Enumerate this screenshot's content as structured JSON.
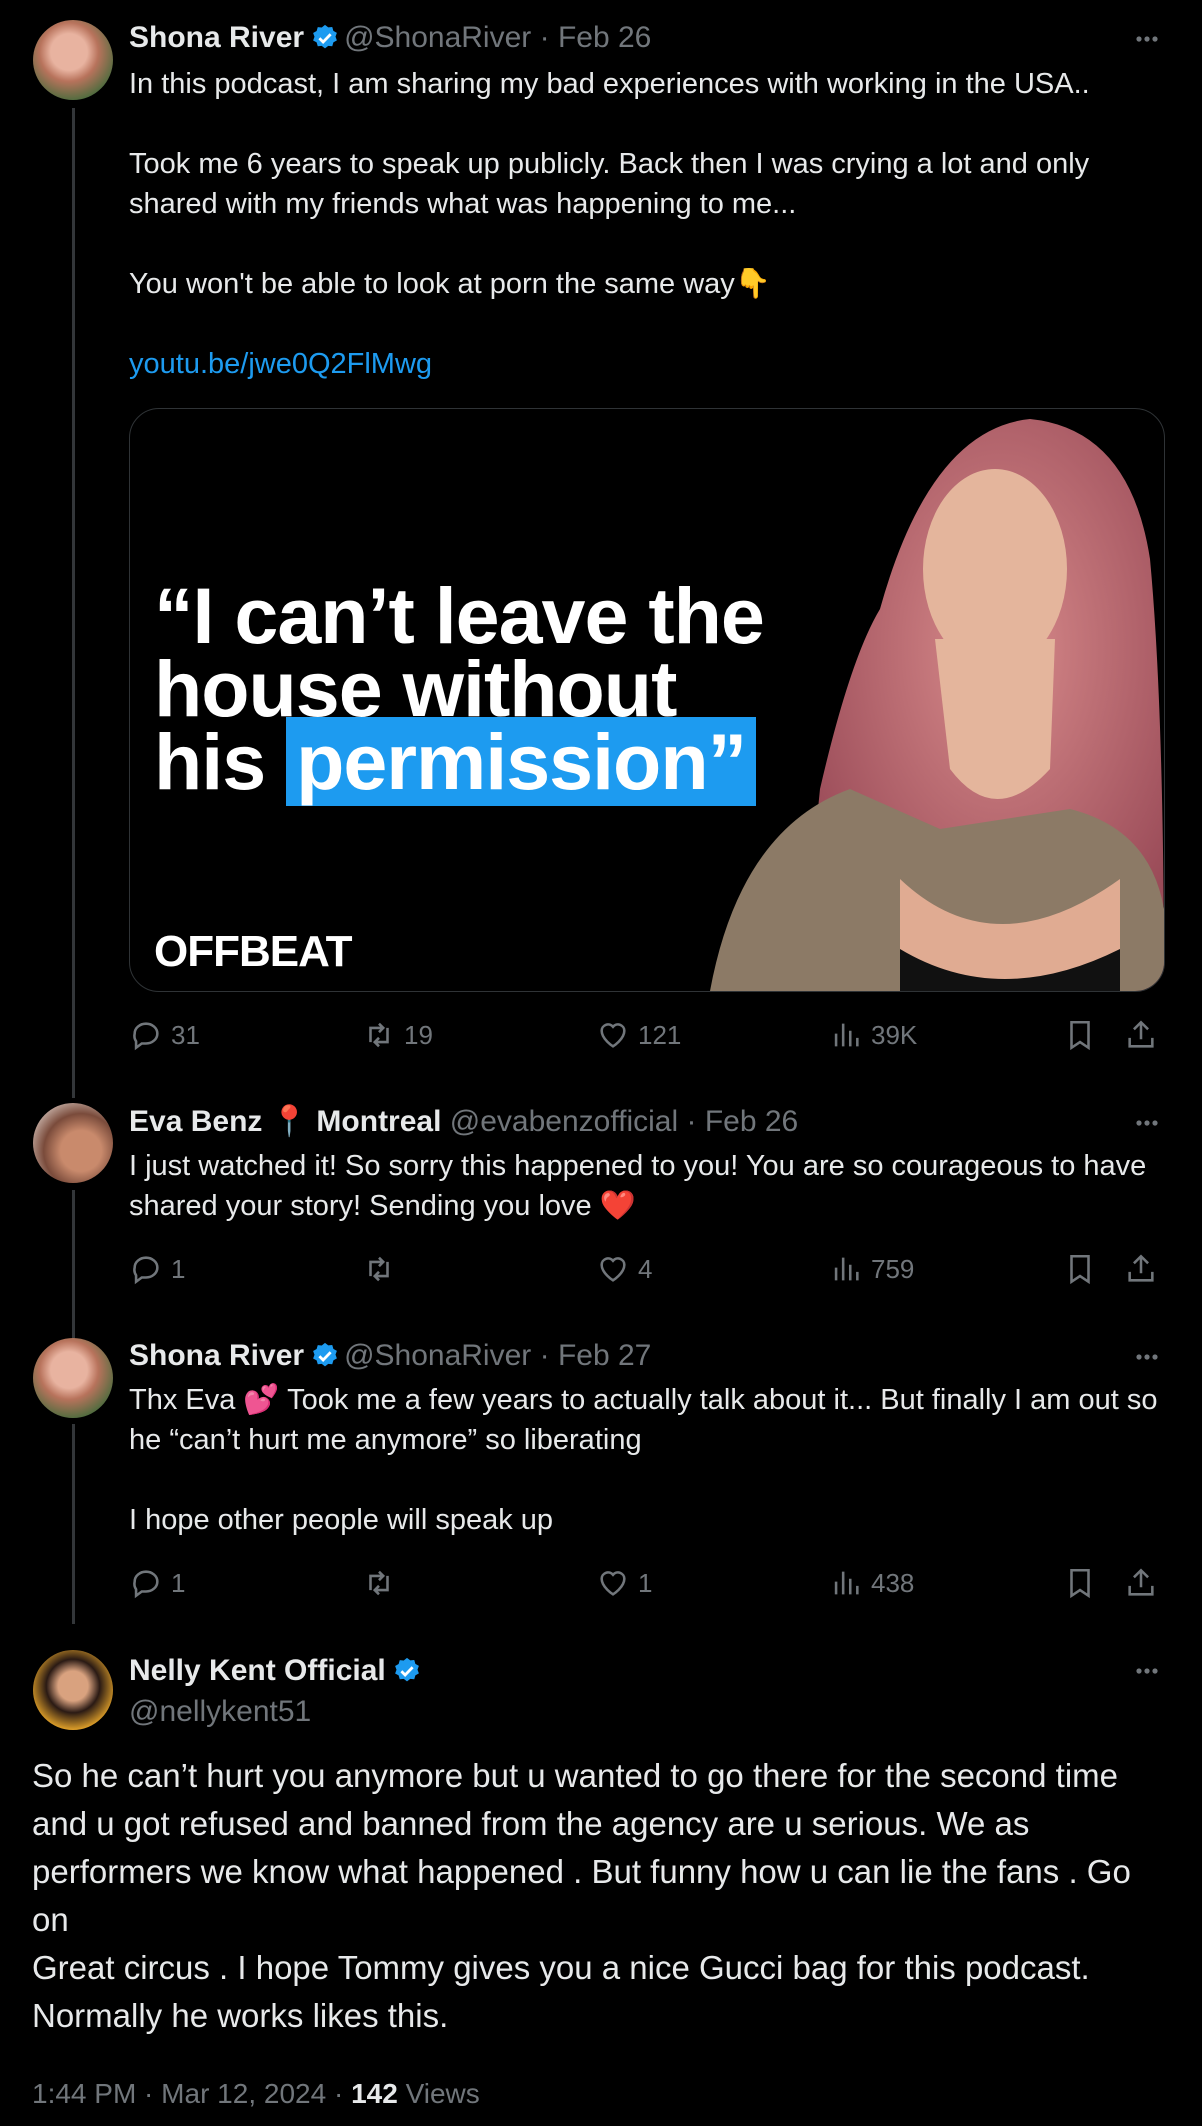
{
  "tweet1": {
    "name": "Shona River",
    "handle": "@ShonaRiver",
    "date": "Feb 26",
    "lines": [
      "In this podcast, I am sharing my bad experiences with working in the USA..",
      "",
      "Took me 6 years to speak up publicly. Back then I was crying a lot and only shared with my friends what was happening to me...",
      "",
      "You won't be able to look at porn the same way👇",
      ""
    ],
    "link": "youtu.be/jwe0Q2FlMwg",
    "card": {
      "quote_line1": "“I can’t leave the",
      "quote_line2": "house without",
      "quote_line3a": "his",
      "quote_line3b": "permission”",
      "brand": "OFFBEAT"
    },
    "replies": "31",
    "reposts": "19",
    "likes": "121",
    "views": "39K"
  },
  "tweet2": {
    "name": "Eva Benz",
    "location": "📍 Montreal",
    "handle": "@evabenzofficial",
    "date": "Feb 26",
    "text": "I just watched it! So sorry this happened to you! You are so courageous to have shared your story! Sending you love ❤️",
    "replies": "1",
    "reposts": "",
    "likes": "4",
    "views": "759"
  },
  "tweet3": {
    "name": "Shona River",
    "handle": "@ShonaRiver",
    "date": "Feb 27",
    "text1": "Thx Eva 💕 Took me a few years to actually talk about it... But finally I am out so he “can’t hurt me anymore” so liberating",
    "text2": "I hope other people will speak up",
    "replies": "1",
    "reposts": "",
    "likes": "1",
    "views": "438"
  },
  "tweet4": {
    "name": "Nelly Kent Official",
    "handle": "@nellykent51",
    "line1": "So he can’t hurt you anymore but u wanted to go there for the second time and u got refused and banned from the agency are u serious. We as performers we know what happened . But funny how u can lie the fans . Go on",
    "line2": "Great circus . I hope Tommy gives you a nice Gucci bag for this podcast. Normally he works likes this.",
    "time": "1:44 PM",
    "date": "Mar 12, 2024",
    "views_count": "142",
    "views_label": "Views"
  },
  "colors": {
    "accent": "#1d9bf0",
    "muted": "#71767b",
    "text": "#e7e9ea",
    "heart": "#f91880"
  }
}
